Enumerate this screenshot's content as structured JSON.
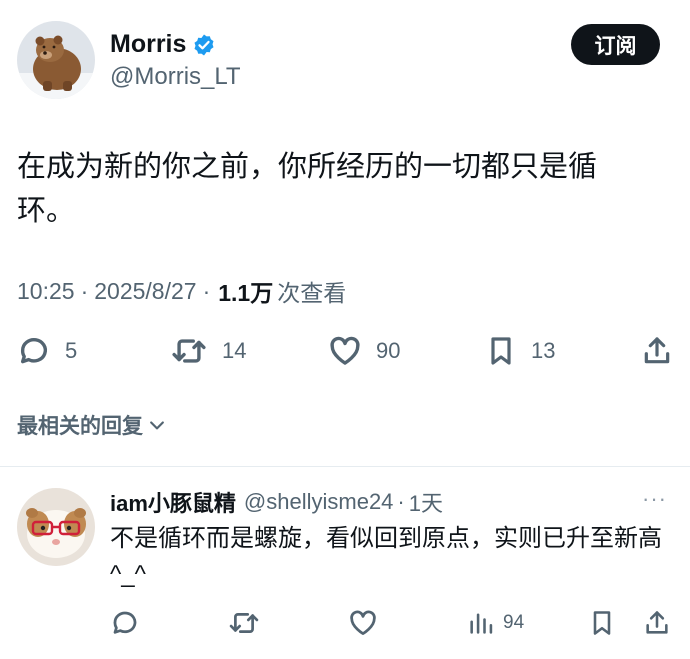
{
  "tweet": {
    "author_name": "Morris",
    "author_handle": "@Morris_LT",
    "subscribe_label": "订阅",
    "text": "在成为新的你之前，你所经历的一切都只是循环。",
    "time": "10:25",
    "date": "2025/8/27",
    "views": "1.1万",
    "views_label": "次查看",
    "separator": "·",
    "stats": {
      "replies": "5",
      "retweets": "14",
      "likes": "90",
      "bookmarks": "13"
    }
  },
  "replies_section": {
    "label": "最相关的回复"
  },
  "reply": {
    "author_name": "iam小豚鼠精",
    "author_handle": "@shellyisme24",
    "separator": "·",
    "age": "1天",
    "more": "···",
    "text": "不是循环而是螺旋，看似回到原点，实则已升至新高^_^",
    "stats": {
      "views": "94"
    }
  },
  "colors": {
    "text": "#0f1419",
    "secondary": "#536471",
    "verified": "#1d9bf0",
    "button_bg": "#0f1419"
  }
}
